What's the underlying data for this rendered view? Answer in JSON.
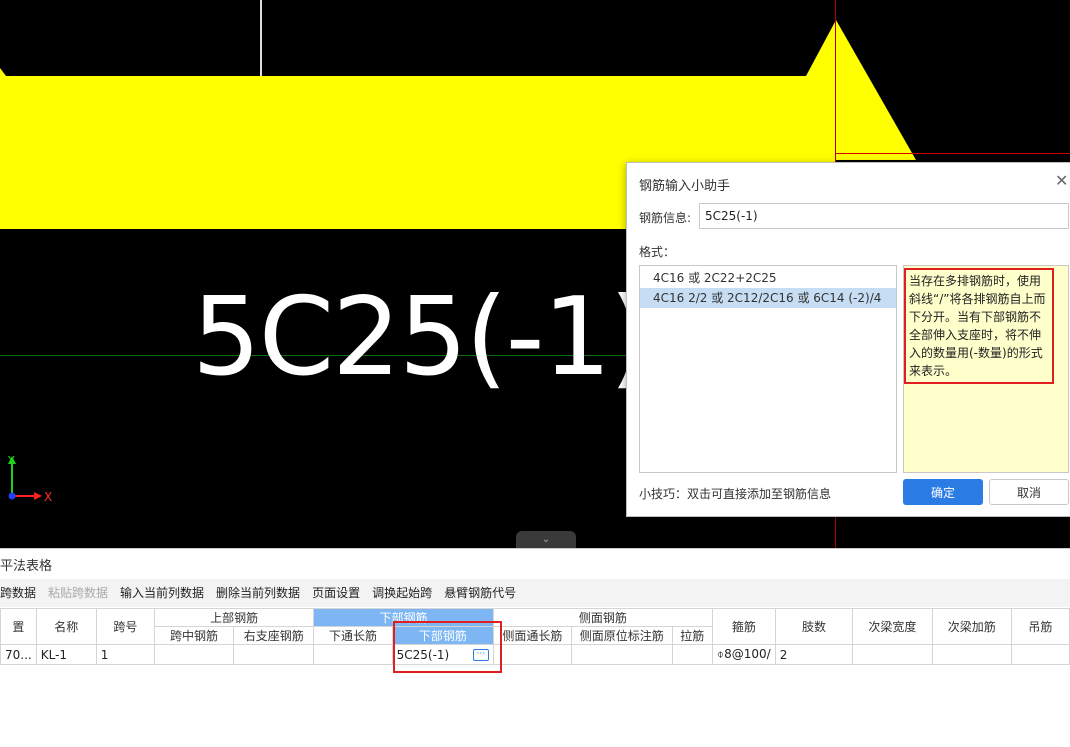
{
  "canvas": {
    "annotation_text": "5C25(-1)",
    "axis": {
      "y_label": "Y",
      "x_label": "X"
    },
    "collapse_icon": "chevron-down-icon",
    "colors": {
      "beam": "#ffff00",
      "background": "#000000"
    }
  },
  "panel": {
    "title": "平法表格",
    "toolbar": [
      {
        "label": "跨数据",
        "disabled": false
      },
      {
        "label": "粘贴跨数据",
        "disabled": true
      },
      {
        "label": "输入当前列数据",
        "disabled": false
      },
      {
        "label": "删除当前列数据",
        "disabled": false
      },
      {
        "label": "页面设置",
        "disabled": false
      },
      {
        "label": "调换起始跨",
        "disabled": false
      },
      {
        "label": "悬臂钢筋代号",
        "disabled": false
      }
    ],
    "table": {
      "group_headers": {
        "top_rebar": "上部钢筋",
        "bottom_rebar": "下部钢筋",
        "side_rebar": "侧面钢筋"
      },
      "headers": {
        "position": "置",
        "name": "名称",
        "span_no": "跨号",
        "mid_span": "跨中钢筋",
        "right_support": "右支座钢筋",
        "bottom_through": "下通长筋",
        "bottom_rebar": "下部钢筋",
        "side_through": "侧面通长筋",
        "side_in_situ": "侧面原位标注筋",
        "tie_bar": "拉筋",
        "stirrup": "箍筋",
        "legs": "肢数",
        "sec_beam_width": "次梁宽度",
        "sec_beam_rebar": "次梁加筋",
        "hanger": "吊筋"
      },
      "row": {
        "position": "70...",
        "name": "KL-1",
        "span_no": "1",
        "mid_span": "",
        "right_support": "",
        "bottom_through": "",
        "bottom_rebar": "5C25(-1)",
        "side_through": "",
        "side_in_situ": "",
        "tie_bar": "",
        "stirrup": "⌽8@100/",
        "legs": "2",
        "sec_beam_width": "",
        "sec_beam_rebar": "",
        "hanger": ""
      },
      "more_button": "···"
    }
  },
  "dialog": {
    "title": "钢筋输入小助手",
    "info_label": "钢筋信息:",
    "info_value": "5C25(-1)",
    "format_label": "格式：",
    "formats": [
      "4C16 或 2C22+2C25",
      "4C16 2/2 或 2C12/2C16 或 6C14 (-2)/4"
    ],
    "selected_format_index": 1,
    "hint": "当存在多排钢筋时，使用斜线“/”将各排钢筋自上而下分开。当有下部钢筋不全部伸入支座时，将不伸入的数量用(-数量)的形式来表示。",
    "tip": "小技巧：双击可直接添加至钢筋信息",
    "ok_label": "确定",
    "cancel_label": "取消",
    "close_icon": "close-icon"
  }
}
